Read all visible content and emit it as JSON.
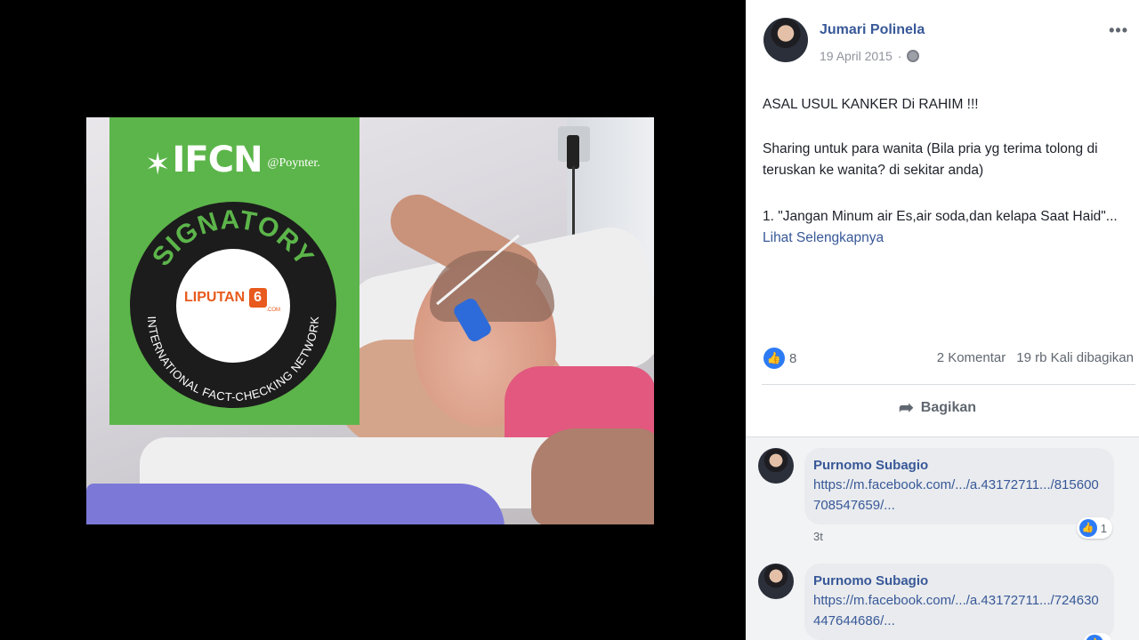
{
  "post": {
    "author": "Jumari Polinela",
    "date": "19 April 2015",
    "privacy_icon": "globe-icon",
    "more_label": "•••",
    "title": "ASAL USUL KANKER Di RAHIM !!!",
    "paragraph_1": "Sharing untuk para wanita (Bila pria yg terima tolong di teruskan ke wanita? di sekitar anda)",
    "paragraph_2": "1. \"Jangan Minum air Es,air soda,dan kelapa Saat Haid\"...",
    "see_more": "Lihat Selengkapnya",
    "reaction_count": "8",
    "comments_count": "2 Komentar",
    "shares_count": "19 rb Kali dibagikan",
    "share_label": "Bagikan"
  },
  "image": {
    "ifcn_text": "IFCN",
    "poynter_text": "@Poynter.",
    "signatory_text": "SIGNATORY",
    "network_text": "INTERNATIONAL FACT-CHECKING NETWORK",
    "liputan_text": "LIPUTAN",
    "liputan_six": "6",
    "liputan_com": ".COM"
  },
  "comments": [
    {
      "name": "Purnomo Subagio",
      "link": "https://m.facebook.com/.../a.43172711.../815600708547659/...",
      "likes": "1",
      "time": "3t"
    },
    {
      "name": "Purnomo Subagio",
      "link": "https://m.facebook.com/.../a.43172711.../724630447644686/...",
      "likes": "",
      "time": ""
    }
  ],
  "colors": {
    "link_blue": "#385898",
    "ifcn_green": "#5cb54a",
    "liputan_orange": "#e85a1d",
    "like_blue": "#2d7bf4"
  }
}
